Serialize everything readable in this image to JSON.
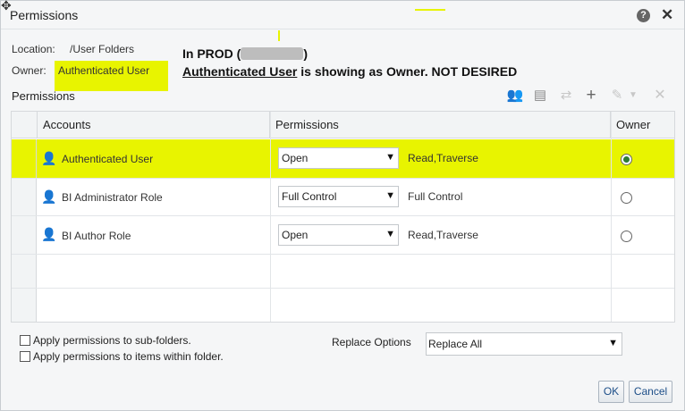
{
  "dialog": {
    "title": "Permissions",
    "help_icon": "?",
    "close_icon": "✕"
  },
  "location": {
    "label": "Location:",
    "value": "/User Folders"
  },
  "owner": {
    "label": "Owner:",
    "value": "Authenticated User"
  },
  "annotation": {
    "line1_prefix": "In PROD (",
    "line1_suffix": ")",
    "line2_underlined": "Authenticated User",
    "line2_rest": " is showing as Owner.  NOT DESIRED"
  },
  "permissions_section": {
    "title": "Permissions"
  },
  "toolbar": {
    "icons": [
      "add-users-icon",
      "add-roles-icon",
      "transfer-icon",
      "add-icon",
      "edit-icon",
      "delete-icon"
    ]
  },
  "table": {
    "headers": {
      "accounts": "Accounts",
      "permissions": "Permissions",
      "owner": "Owner"
    },
    "rows": [
      {
        "account": "Authenticated User",
        "permission": "Open",
        "detail": "Read,Traverse",
        "owner": true,
        "selected": true
      },
      {
        "account": "BI Administrator Role",
        "permission": "Full Control",
        "detail": "Full Control",
        "owner": false,
        "selected": false
      },
      {
        "account": "BI Author Role",
        "permission": "Open",
        "detail": "Read,Traverse",
        "owner": false,
        "selected": false
      }
    ]
  },
  "options": {
    "apply_subfolders": "Apply permissions to sub-folders.",
    "apply_items": "Apply permissions to items within folder.",
    "replace_label": "Replace Options",
    "replace_value": "Replace All"
  },
  "buttons": {
    "ok": "OK",
    "cancel": "Cancel"
  },
  "colors": {
    "highlight": "#e8f400",
    "button_text": "#1c4e88"
  }
}
